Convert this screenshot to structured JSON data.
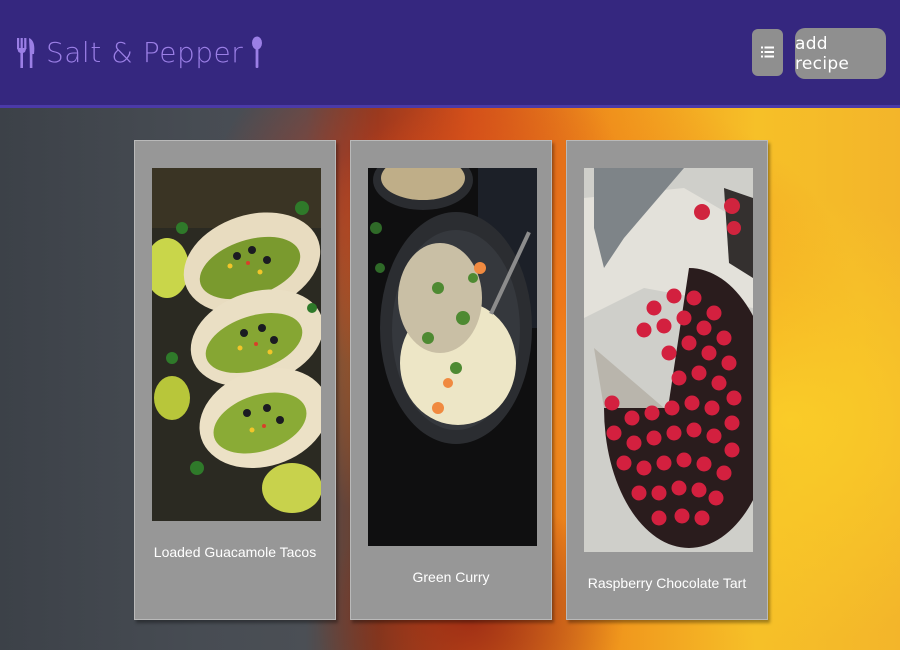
{
  "app": {
    "title": "Salt & Pepper",
    "brand_left_icon": "fork-knife-icon",
    "brand_right_icon": "spoon-icon",
    "brand_color": "#9b7fe6",
    "header_color": "#35277f"
  },
  "toolbar": {
    "menu_icon": "list-icon",
    "add_recipe_label": "add recipe",
    "button_color": "#8f8f8f"
  },
  "recipes": [
    {
      "title": "Loaded Guacamole Tacos",
      "image": "guacamole-tacos-photo"
    },
    {
      "title": "Green Curry",
      "image": "green-curry-photo"
    },
    {
      "title": "Raspberry Chocolate Tart",
      "image": "raspberry-tart-photo"
    }
  ]
}
